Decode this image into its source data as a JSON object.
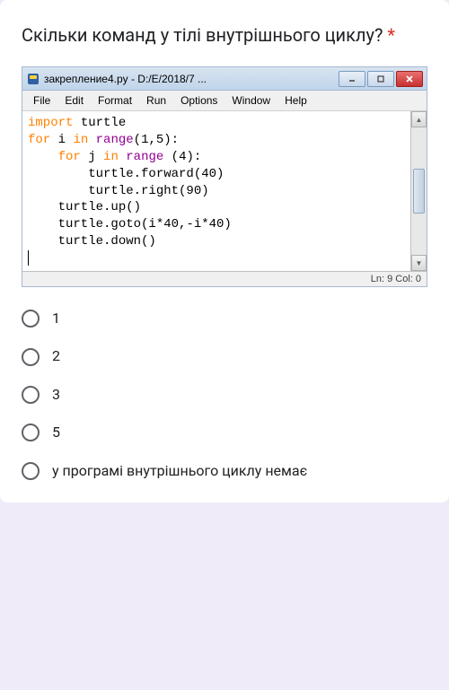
{
  "question": {
    "text": "Скільки команд у тілі внутрішнього циклу?",
    "required_mark": "*"
  },
  "window": {
    "title": "закрепление4.py - D:/E/2018/7 ...",
    "menu": [
      "File",
      "Edit",
      "Format",
      "Run",
      "Options",
      "Window",
      "Help"
    ],
    "code": {
      "l1_kw": "import",
      "l1_rest": " turtle",
      "l2_kw": "for",
      "l2_a": " i ",
      "l2_in": "in",
      "l2_b": " ",
      "l2_fn": "range",
      "l2_c": "(1,5):",
      "l3_pad": "    ",
      "l3_kw": "for",
      "l3_a": " j ",
      "l3_in": "in",
      "l3_b": " ",
      "l3_fn": "range",
      "l3_c": " (4):",
      "l4": "        turtle.forward(40)",
      "l5": "        turtle.right(90)",
      "l6": "    turtle.up()",
      "l7": "    turtle.goto(i*40,-i*40)",
      "l8": "    turtle.down()"
    },
    "status": "Ln: 9  Col: 0"
  },
  "options": [
    {
      "label": "1"
    },
    {
      "label": "2"
    },
    {
      "label": "3"
    },
    {
      "label": "5"
    },
    {
      "label": "у програмі внутрішнього циклу немає"
    }
  ]
}
